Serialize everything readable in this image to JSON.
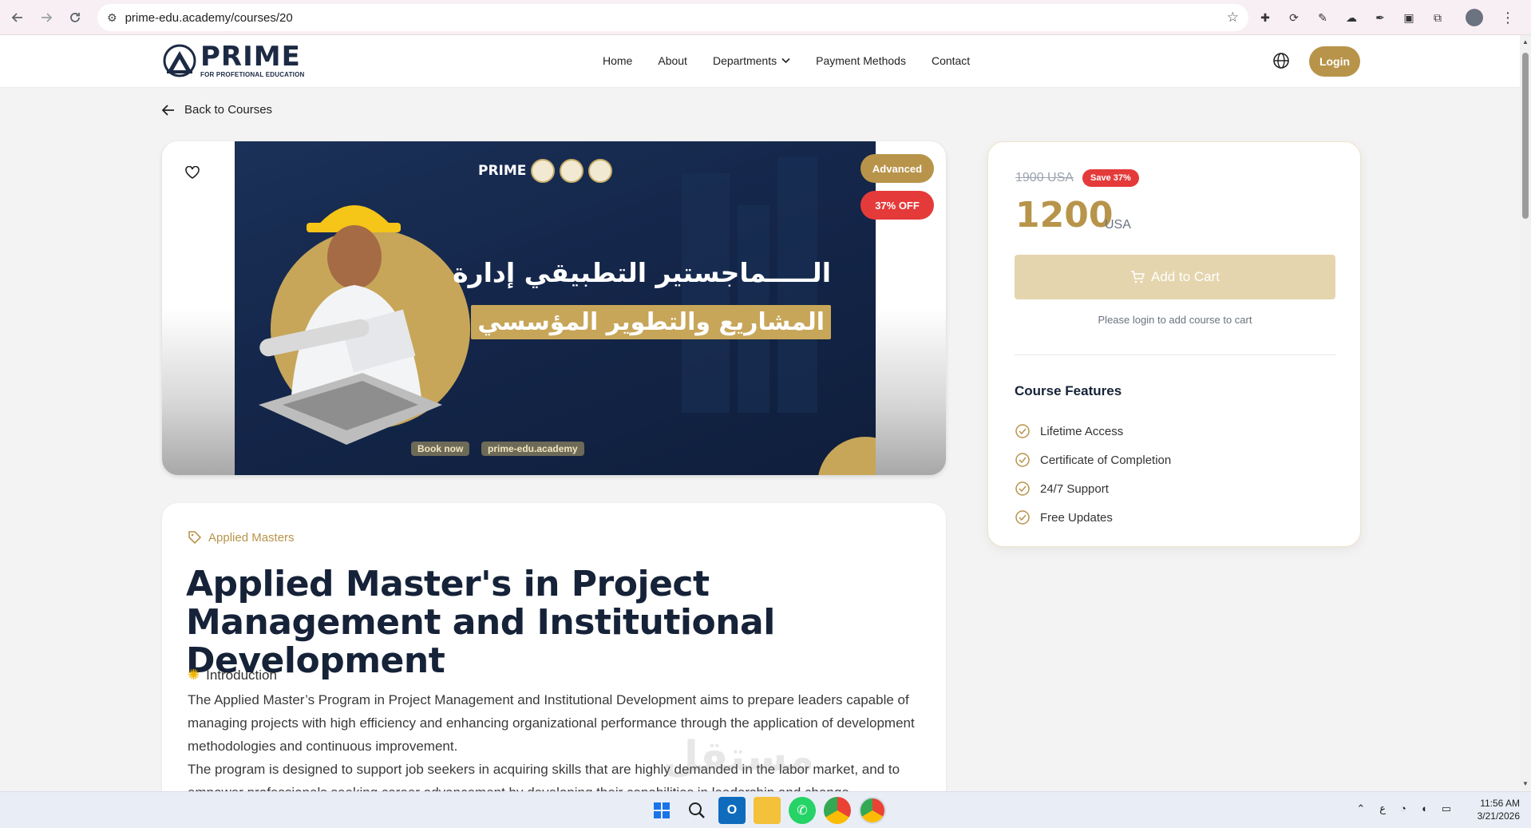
{
  "browser": {
    "url": "prime-edu.academy/courses/20",
    "back_icon": "arrow-left-icon",
    "forward_icon": "arrow-right-icon",
    "reload_icon": "reload-icon"
  },
  "header": {
    "brand_name": "PRIME",
    "brand_tagline": "FOR PROFETIONAL EDUCATION",
    "nav": [
      "Home",
      "About",
      "Departments",
      "Payment Methods",
      "Contact"
    ],
    "login_label": "Login"
  },
  "back_link": "Back to Courses",
  "hero": {
    "banner_brand": "PRIME",
    "arabic_line_1": "الـــــماجستير التطبيقي إدارة",
    "arabic_line_2": "المشاريع والتطوير المؤسسي",
    "chip_book": "Book now",
    "chip_site": "prime-edu.academy",
    "level_badge": "Advanced",
    "discount_badge": "37% OFF"
  },
  "course": {
    "category": "Applied Masters",
    "title": "Applied Master's in Project Management and Institutional Development",
    "intro_heading": "Introduction",
    "intro_paragraph_1": "The Applied Master’s Program in Project Management and Institutional Development aims to prepare leaders capable of managing projects with high efficiency and enhancing organizational performance through the application of development methodologies and continuous improvement.",
    "intro_paragraph_2": "The program is designed to support job seekers in acquiring skills that are highly demanded in the labor market, and to empower professionals seeking career advancement by developing their capabilities in leadership and change"
  },
  "pricing": {
    "old_price": "1900 USA",
    "save_badge": "Save 37%",
    "price": "1200",
    "currency": "USA",
    "cart_label": "Add to Cart",
    "login_note": "Please login to add course to cart",
    "features_title": "Course Features",
    "features": [
      "Lifetime Access",
      "Certificate of Completion",
      "24/7 Support",
      "Free Updates"
    ]
  },
  "taskbar": {
    "keyboard_lang": "ع",
    "time": "11:56 AM",
    "date": "3/21/2026"
  },
  "watermark": "مستقل",
  "colors": {
    "gold": "#b8944a",
    "navy": "#152238",
    "red": "#e53a3a",
    "cart_disabled": "#e5d5ae"
  }
}
